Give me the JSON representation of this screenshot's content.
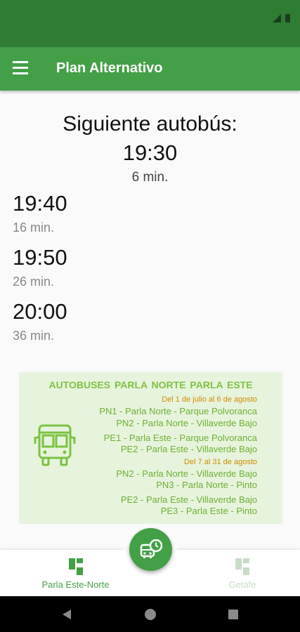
{
  "app_title": "Plan Alternativo",
  "next": {
    "label": "Siguiente autobús:",
    "time": "19:30",
    "minutes": "6 min."
  },
  "departures": [
    {
      "time": "19:40",
      "minutes": "16 min."
    },
    {
      "time": "19:50",
      "minutes": "26 min."
    },
    {
      "time": "20:00",
      "minutes": "36 min."
    }
  ],
  "banner": {
    "title": "AUTOBUSES PARLA NORTE    PARLA ESTE",
    "period1": "Del 1 de julio al 6 de agosto",
    "lines1a": [
      "PN1 - Parla Norte - Parque Polvoranca",
      "PN2 - Parla Norte - Villaverde Bajo"
    ],
    "lines1b": [
      "PE1 - Parla Este - Parque Polvoranca",
      "PE2 - Parla Este - Villaverde Bajo"
    ],
    "period2": "Del 7 al 31 de agosto",
    "lines2a": [
      "PN2 - Parla Norte - Villaverde Bajo",
      "PN3 - Parla Norte - Pinto"
    ],
    "lines2b": [
      "PE2 - Parla Este - Villaverde Bajo",
      "PE3 - Parla Este - Pinto"
    ]
  },
  "nav": {
    "tab1": "Parla Este-Norte",
    "tab2": "Getafe"
  },
  "colors": {
    "primary": "#43a047",
    "primary_dark": "#2e7d32",
    "inactive": "#c8dcc8",
    "banner_bg": "#e7f4dd",
    "banner_text": "#6bb032",
    "period_text": "#d18a00"
  },
  "icons": {
    "menu": "hamburger-icon",
    "banner": "bus-icon",
    "fab": "bus-clock-icon",
    "tab": "dashboard-icon"
  }
}
